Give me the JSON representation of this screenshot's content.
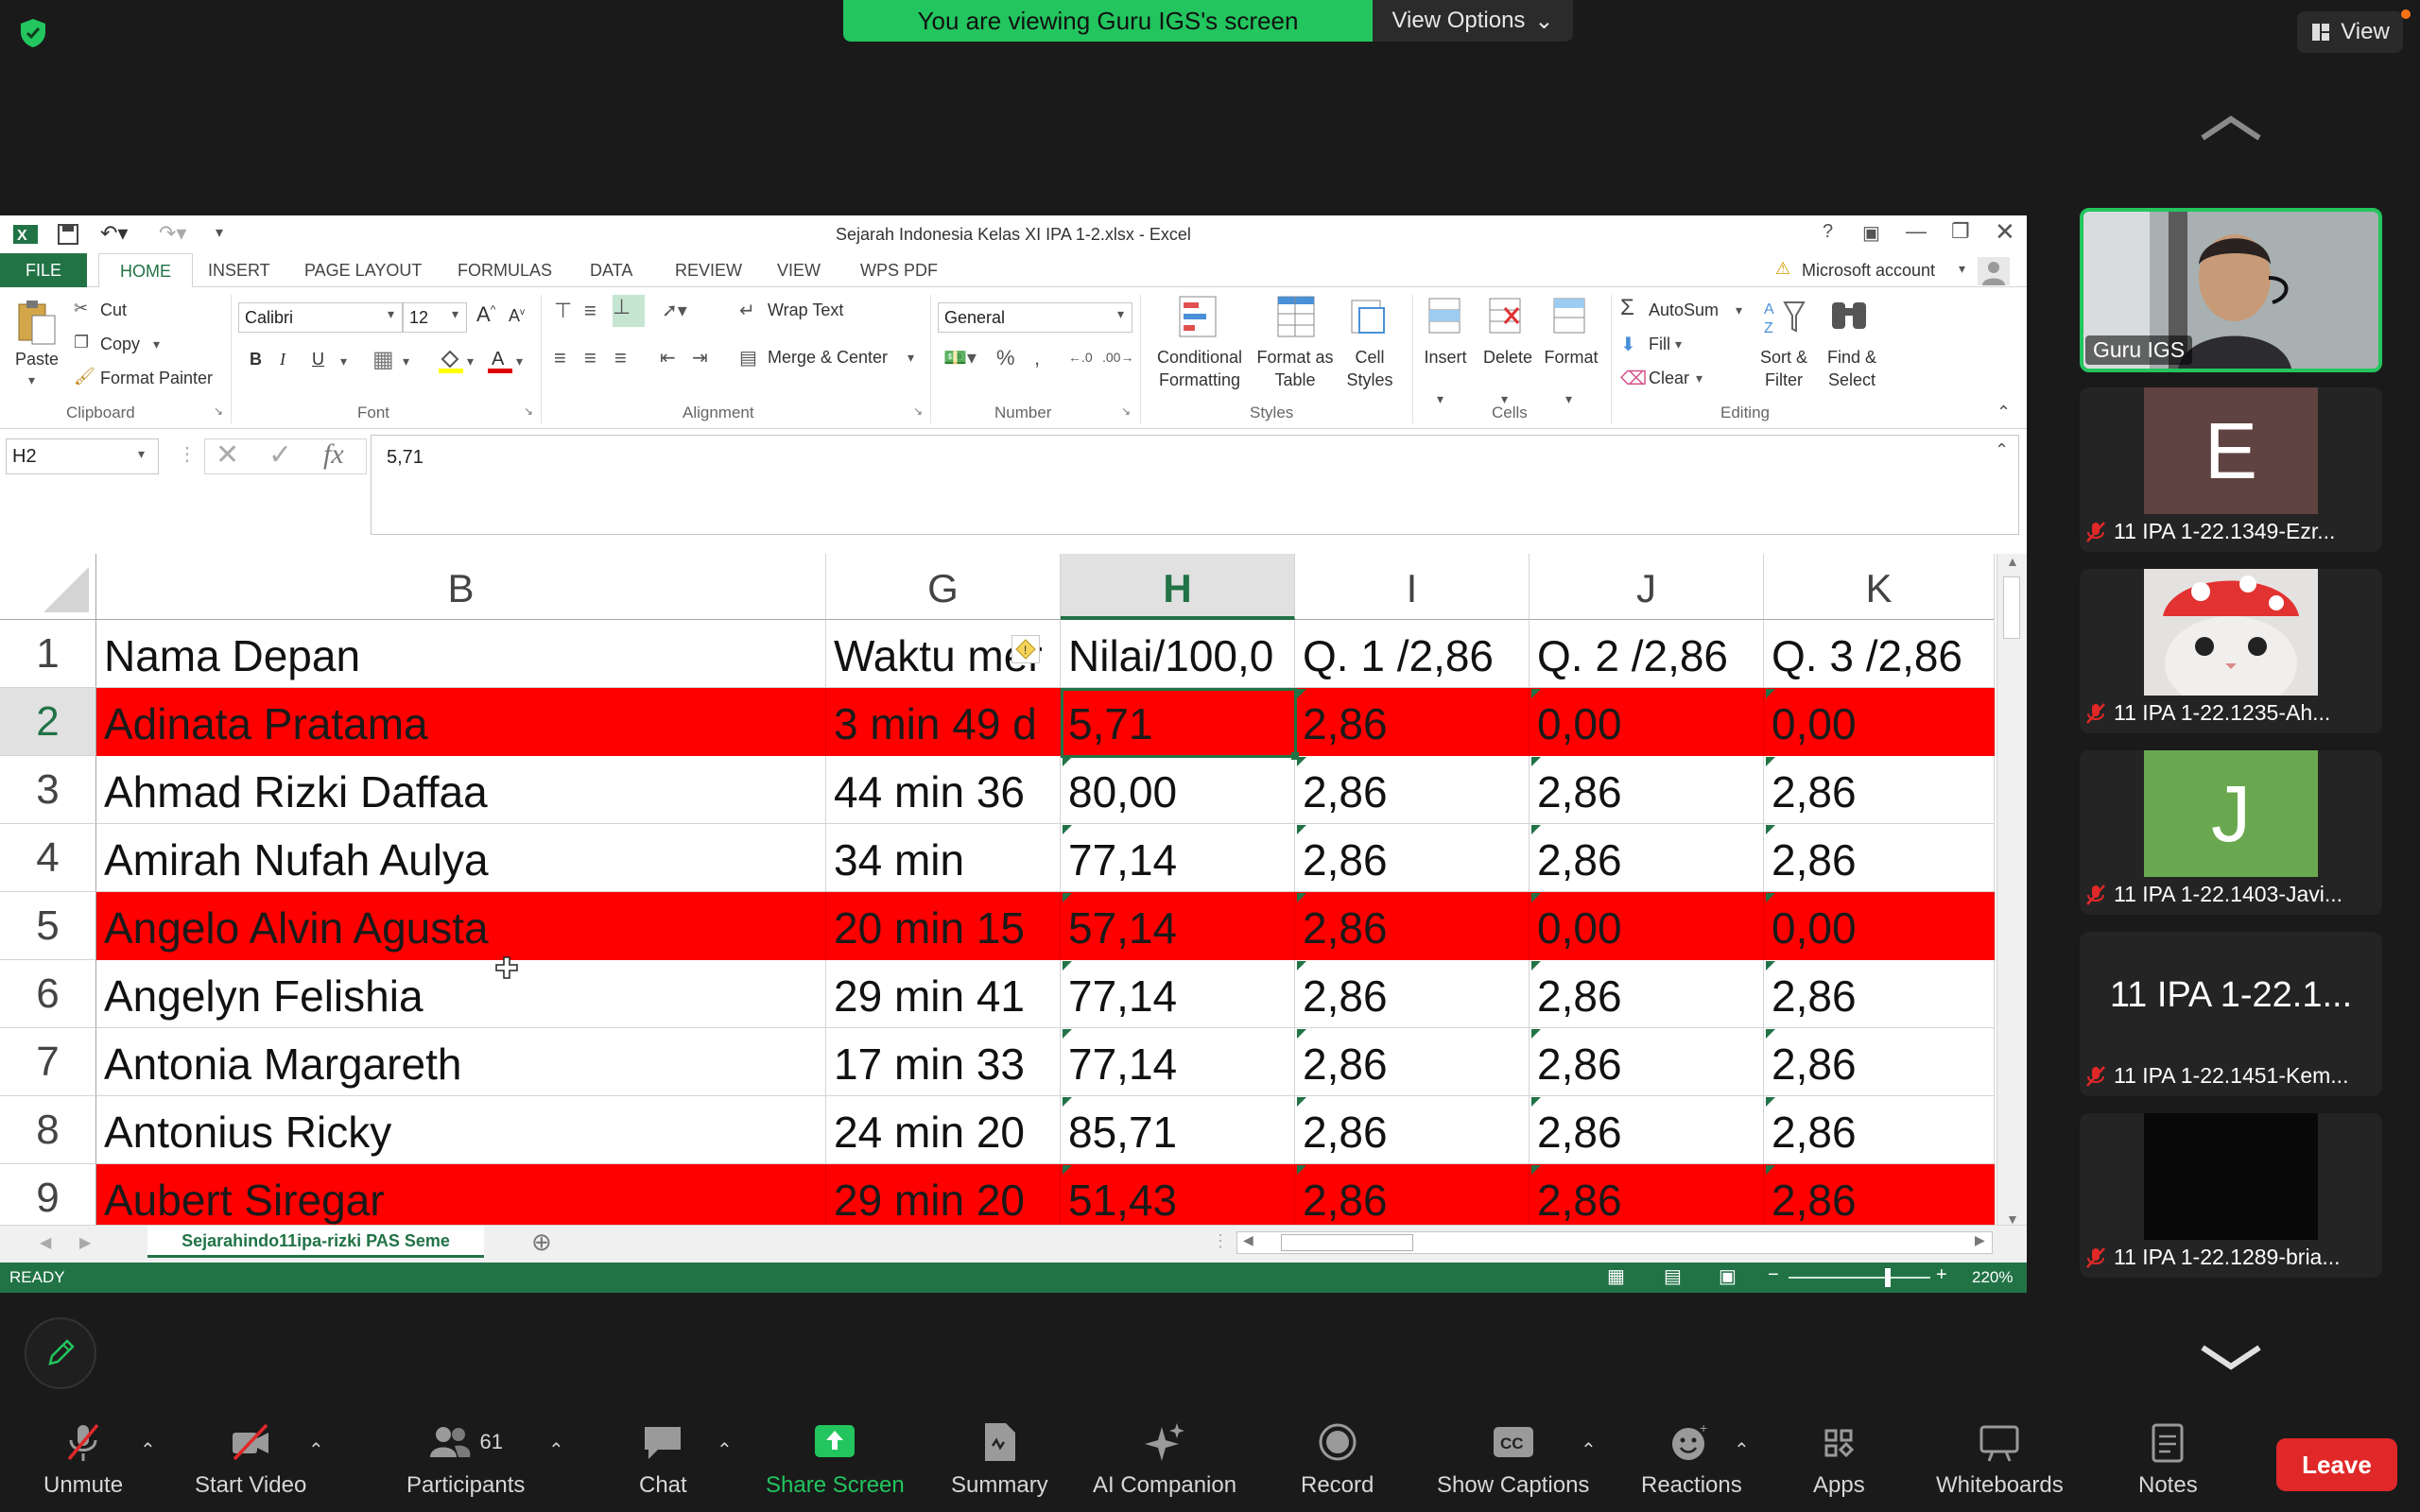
{
  "zoom": {
    "banner_text": "You are viewing Guru IGS's screen",
    "view_options": "View Options",
    "view_label": "View"
  },
  "excel": {
    "title": "Sejarah Indonesia Kelas XI IPA 1-2.xlsx - Excel",
    "tabs": [
      "FILE",
      "HOME",
      "INSERT",
      "PAGE LAYOUT",
      "FORMULAS",
      "DATA",
      "REVIEW",
      "VIEW",
      "WPS PDF"
    ],
    "account": "Microsoft account",
    "clipboard": {
      "paste": "Paste",
      "cut": "Cut",
      "copy": "Copy",
      "format_painter": "Format Painter",
      "label": "Clipboard"
    },
    "font": {
      "name": "Calibri",
      "size": "12",
      "label": "Font"
    },
    "alignment": {
      "wrap_text": "Wrap Text",
      "merge_center": "Merge & Center",
      "label": "Alignment"
    },
    "number": {
      "format": "General",
      "label": "Number"
    },
    "styles": {
      "conditional": "Conditional\nFormatting",
      "cond1": "Conditional",
      "cond2": "Formatting",
      "fmt_table1": "Format as",
      "fmt_table2": "Table",
      "cell_styles1": "Cell",
      "cell_styles2": "Styles",
      "label": "Styles"
    },
    "cells": {
      "insert": "Insert",
      "delete": "Delete",
      "format": "Format",
      "label": "Cells"
    },
    "editing": {
      "autosum": "AutoSum",
      "fill": "Fill",
      "clear": "Clear",
      "sort1": "Sort &",
      "sort2": "Filter",
      "find1": "Find &",
      "find2": "Select",
      "label": "Editing"
    },
    "name_box": "H2",
    "formula": "5,71",
    "columns": [
      "B",
      "G",
      "H",
      "I",
      "J",
      "K"
    ],
    "rows": [
      {
        "num": "1",
        "cells": [
          "Nama Depan",
          "Waktu mer",
          "Nilai/100,0",
          "Q. 1 /2,86",
          "Q. 2 /2,86",
          "Q. 3 /2,86"
        ],
        "red": false
      },
      {
        "num": "2",
        "cells": [
          "Adinata Pratama",
          "3 min 49 d",
          "5,71",
          "2,86",
          "0,00",
          "0,00"
        ],
        "red": true
      },
      {
        "num": "3",
        "cells": [
          "Ahmad Rizki Daffaa",
          "44 min 36",
          "80,00",
          "2,86",
          "2,86",
          "2,86"
        ],
        "red": false
      },
      {
        "num": "4",
        "cells": [
          "Amirah Nufah Aulya",
          "34 min",
          "77,14",
          "2,86",
          "2,86",
          "2,86"
        ],
        "red": false
      },
      {
        "num": "5",
        "cells": [
          "Angelo Alvin Agusta",
          "20 min 15",
          "57,14",
          "2,86",
          "0,00",
          "0,00"
        ],
        "red": true
      },
      {
        "num": "6",
        "cells": [
          "Angelyn Felishia",
          "29 min 41",
          "77,14",
          "2,86",
          "2,86",
          "2,86"
        ],
        "red": false
      },
      {
        "num": "7",
        "cells": [
          "Antonia Margareth",
          "17 min 33",
          "77,14",
          "2,86",
          "2,86",
          "2,86"
        ],
        "red": false
      },
      {
        "num": "8",
        "cells": [
          "Antonius Ricky",
          "24 min 20",
          "85,71",
          "2,86",
          "2,86",
          "2,86"
        ],
        "red": false
      },
      {
        "num": "9",
        "cells": [
          "Aubert Siregar",
          "29 min 20",
          "51,43",
          "2,86",
          "2,86",
          "2,86"
        ],
        "red": true
      }
    ],
    "sheet_tab": "Sejarahindo11ipa-rizki PAS Seme",
    "status": "READY",
    "zoom_level": "220%"
  },
  "participants": [
    {
      "name": "Guru IGS",
      "avatar": "",
      "color": "#9aa3a6"
    },
    {
      "name": "11 IPA 1-22.1349-Ezr...",
      "avatar": "E",
      "color": "#5e4340"
    },
    {
      "name": "11 IPA 1-22.1235-Ah...",
      "avatar": "",
      "color": "#cfcfcf"
    },
    {
      "name": "11 IPA 1-22.1403-Javi...",
      "avatar": "J",
      "color": "#6aa84f"
    },
    {
      "name": "11 IPA 1-22.1451-Kem...",
      "avatar": "11 IPA 1-22.1...",
      "color": "#242424"
    },
    {
      "name": "11 IPA 1-22.1289-bria...",
      "avatar": "",
      "color": "#080808"
    }
  ],
  "toolbar": {
    "unmute": "Unmute",
    "start_video": "Start Video",
    "participants": "Participants",
    "participants_count": "61",
    "chat": "Chat",
    "share_screen": "Share Screen",
    "summary": "Summary",
    "ai_companion": "AI Companion",
    "record": "Record",
    "show_captions": "Show Captions",
    "reactions": "Reactions",
    "apps": "Apps",
    "whiteboards": "Whiteboards",
    "notes": "Notes",
    "leave": "Leave"
  },
  "colors": {
    "excel_green": "#217346",
    "zoom_green": "#22c55e",
    "leave_red": "#e02828",
    "row_red": "#ff0000"
  }
}
